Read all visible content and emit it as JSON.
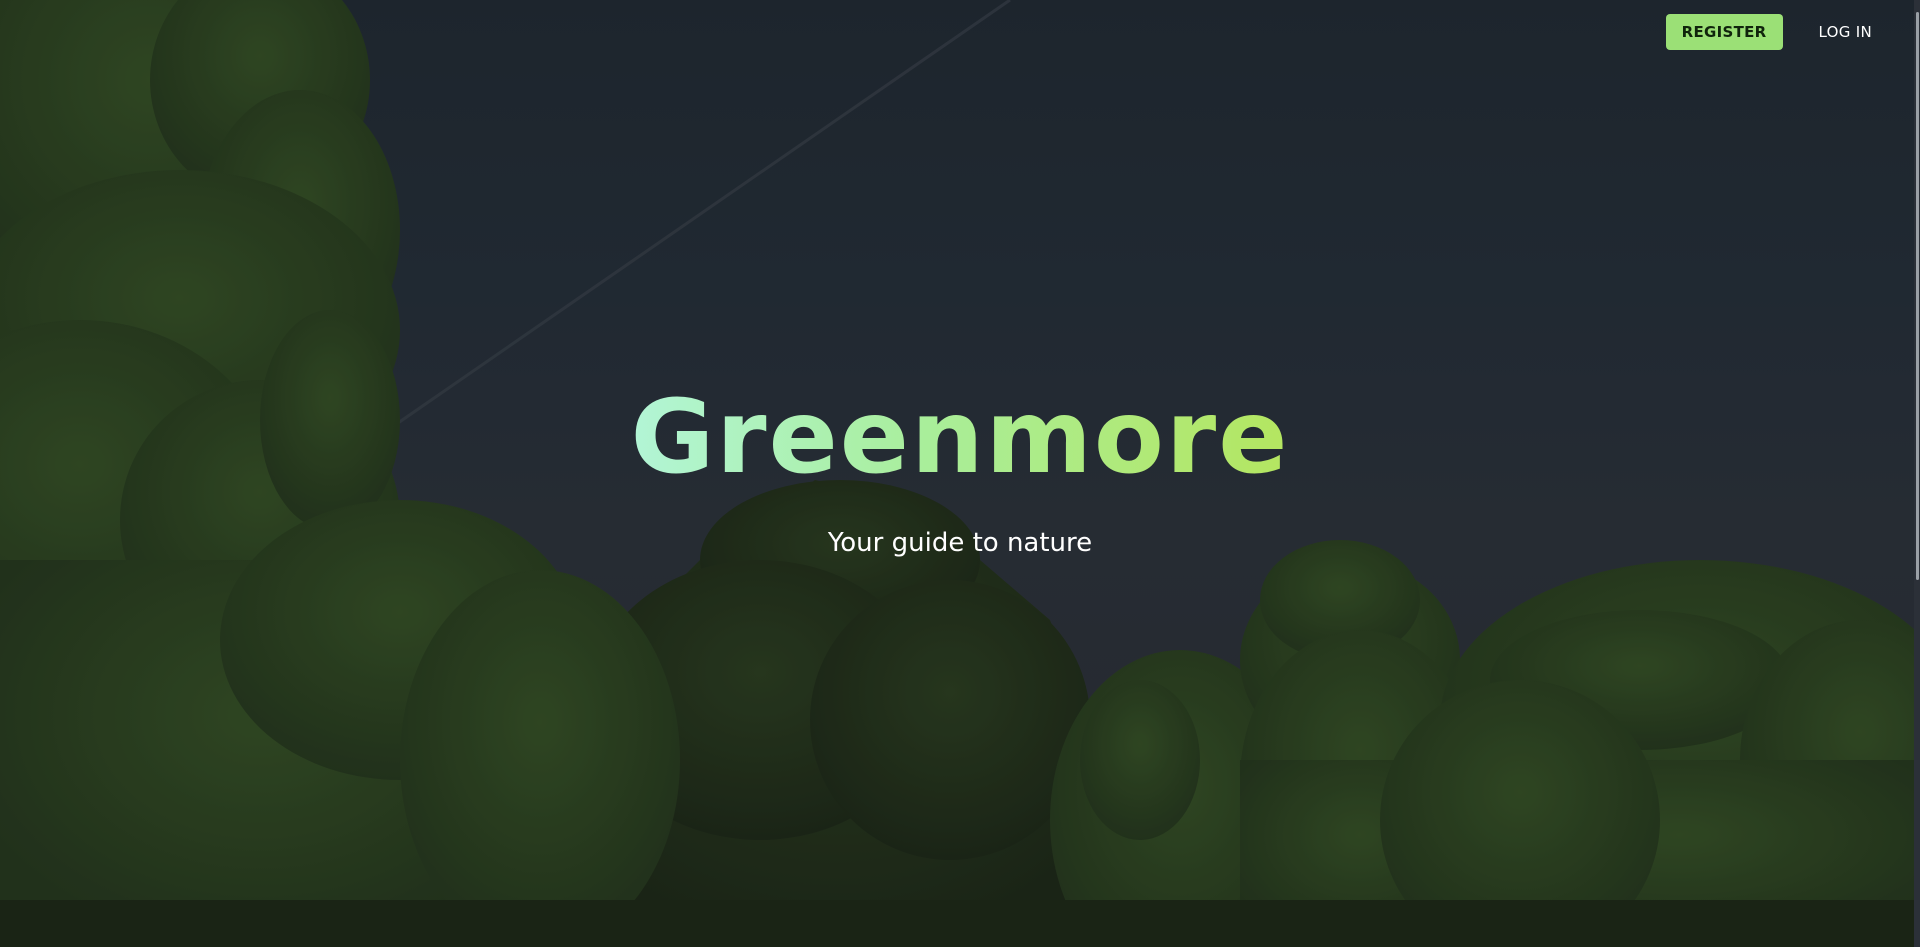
{
  "nav": {
    "register_label": "REGISTER",
    "login_label": "LOG IN"
  },
  "hero": {
    "title": "Greenmore",
    "subtitle": "Your guide to nature"
  },
  "colors": {
    "accent": "#9be076",
    "title_gradient_start": "#b2f5d6",
    "title_gradient_end": "#b4e660",
    "sky": "#222b35",
    "foliage": "#2e4a1e"
  }
}
